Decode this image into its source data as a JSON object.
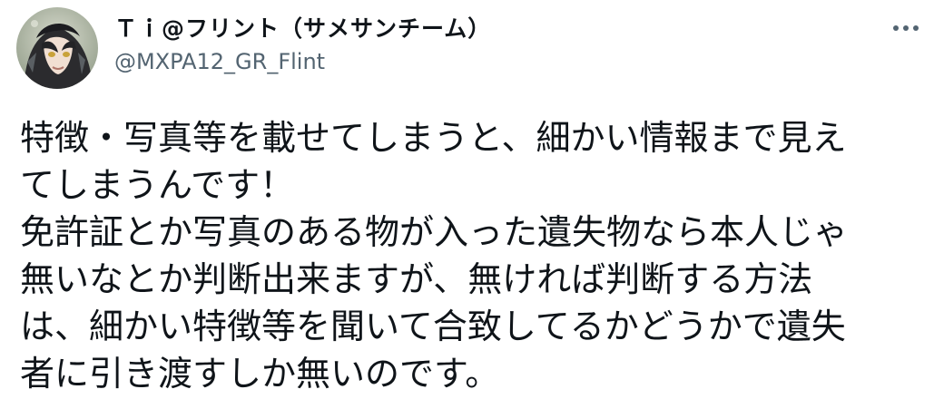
{
  "tweet": {
    "author": {
      "display_name": "Ｔｉ@フリント（サメサンチーム）",
      "handle": "@MXPA12_GR_Flint",
      "avatar_icon": "profile-avatar-anime-character"
    },
    "more_icon": "more-horizontal-icon",
    "text_lines": [
      "特徴・写真等を載せてしまうと、細かい情報まで見え",
      "てしまうんです！",
      "免許証とか写真のある物が入った遺失物なら本人じゃ",
      "無いなとか判断出来ますが、無ければ判断する方法",
      "は、細かい特徴等を聞いて合致してるかどうかで遺失",
      "者に引き渡すしか無いのです。"
    ]
  },
  "colors": {
    "text_primary": "#0f1419",
    "text_secondary": "#536471",
    "background": "#ffffff"
  }
}
